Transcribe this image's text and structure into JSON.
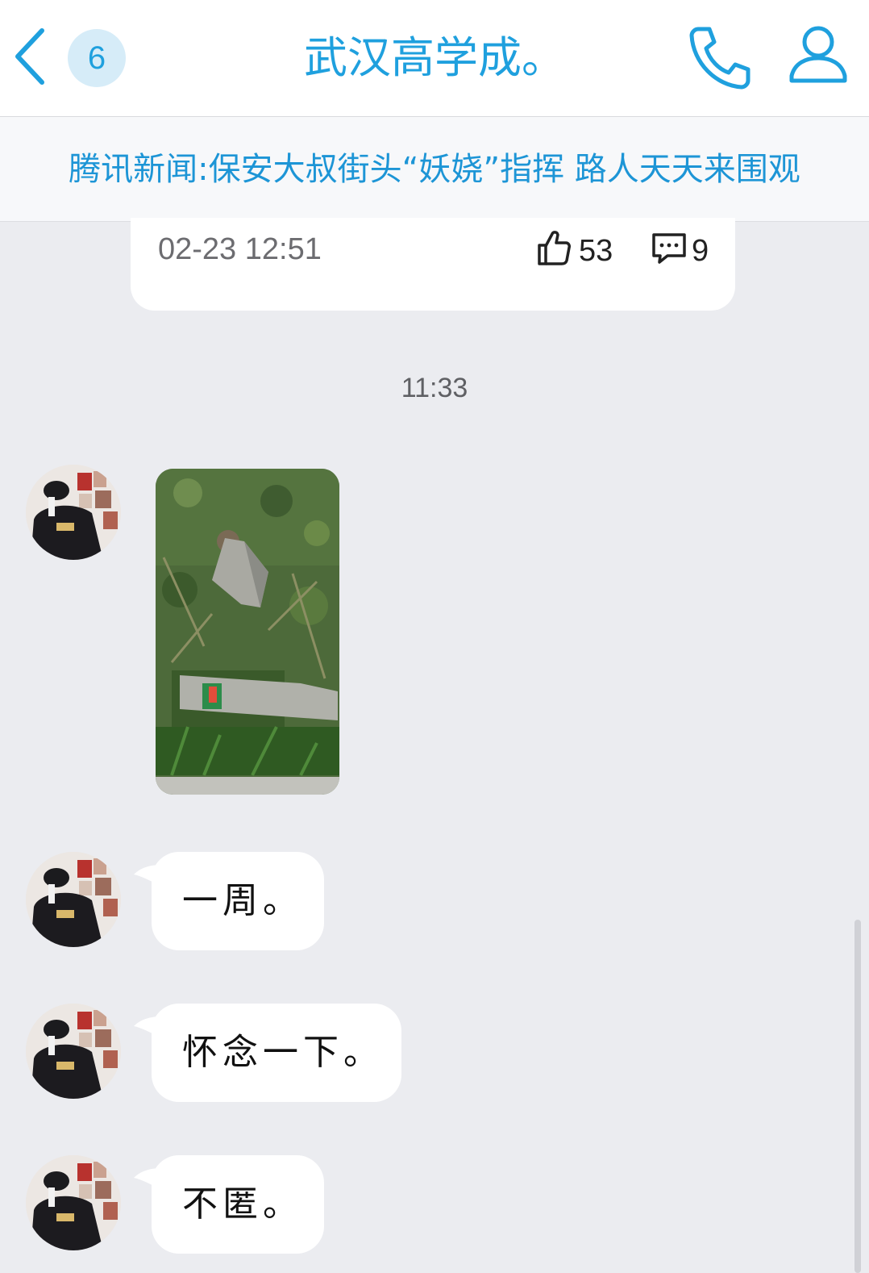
{
  "header": {
    "title": "武汉高学成。",
    "unread_count": "6",
    "accent_color": "#1fa0de",
    "icons": [
      "back-chevron-icon",
      "phone-icon",
      "person-icon"
    ]
  },
  "news": {
    "headline": "腾讯新闻:保安大叔街头“妖娆”指挥 路人天天来围观",
    "time": "02-23 12:51",
    "likes": "53",
    "comments": "9"
  },
  "chat": {
    "time_separator": "11:33",
    "messages": [
      {
        "type": "image",
        "content": "photo of broken stone marker in grass"
      },
      {
        "type": "text",
        "text": "一周。"
      },
      {
        "type": "text",
        "text": "怀念一下。"
      },
      {
        "type": "text",
        "text": "不匿。"
      }
    ]
  }
}
